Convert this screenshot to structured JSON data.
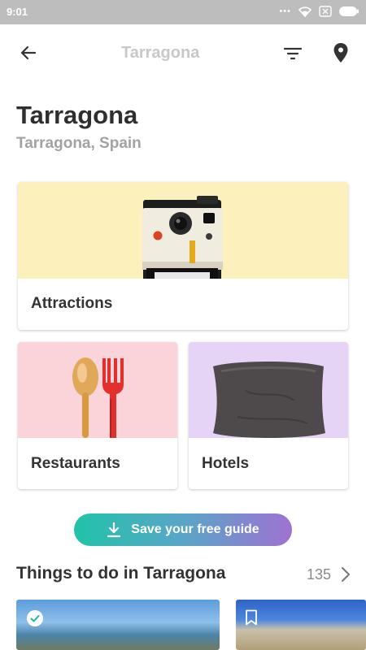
{
  "status_bar": {
    "time": "9:01",
    "battery_icon": "battery-icon",
    "wifi_icon": "wifi-icon"
  },
  "app_bar": {
    "title": "Tarragona",
    "back_icon": "arrow-left-icon",
    "filter_icon": "filter-icon",
    "map_icon": "map-pin-icon"
  },
  "header": {
    "title": "Tarragona",
    "subtitle": "Tarragona, Spain"
  },
  "categories": [
    {
      "label": "Attractions",
      "color": "#fcf1bc",
      "icon": "instant-camera"
    },
    {
      "label": "Restaurants",
      "color": "#fbd4da",
      "icon": "spoon-and-fork"
    },
    {
      "label": "Hotels",
      "color": "#e6d4f6",
      "icon": "pillow"
    }
  ],
  "save_button": {
    "label": "Save your free guide",
    "icon": "download-icon"
  },
  "things_to_do": {
    "title": "Things to do in Tarragona",
    "count": "135"
  },
  "colors": {
    "accent_start": "#20c3a8",
    "accent_end": "#9f72d3"
  }
}
